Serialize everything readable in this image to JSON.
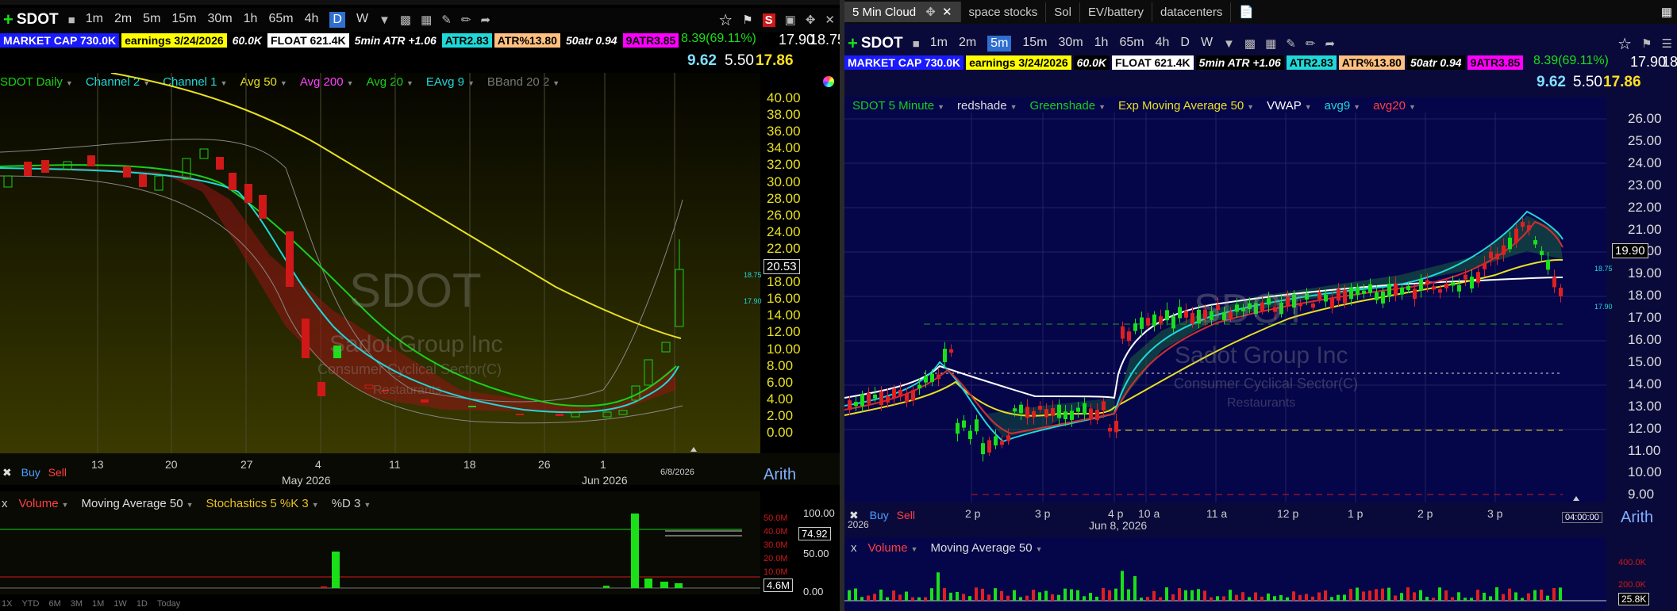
{
  "left": {
    "symbol": "SDOT",
    "timeframes": [
      "1m",
      "2m",
      "5m",
      "15m",
      "30m",
      "1h",
      "65m",
      "4h",
      "D",
      "W"
    ],
    "active_tf": "D",
    "badges": [
      {
        "text": "MARKET CAP 730.0K",
        "bg": "#1a1aff",
        "fg": "#fff"
      },
      {
        "text": "earnings 3/24/2026",
        "bg": "#ffff00",
        "fg": "#000"
      },
      {
        "text": "60.0K",
        "bg": "#000",
        "fg": "#fff"
      },
      {
        "text": "FLOAT 621.4K",
        "bg": "#ffffff",
        "fg": "#000"
      },
      {
        "text": "5min ATR +1.06",
        "bg": "#000",
        "fg": "#fff"
      },
      {
        "text": "ATR2.83",
        "bg": "#20d8d8",
        "fg": "#000"
      },
      {
        "text": "ATR%13.80",
        "bg": "#ffc080",
        "fg": "#000"
      },
      {
        "text": "50atr 0.94",
        "bg": "#000",
        "fg": "#fff"
      },
      {
        "text": "9ATR3.85",
        "bg": "#ff00ff",
        "fg": "#000"
      }
    ],
    "change": "8.39(69.11%)",
    "bid": "17.90",
    "ask": "18.75",
    "stat1": "9.62",
    "stat2": "5.50",
    "stat3": "17.86",
    "studies": [
      {
        "label": "SDOT Daily",
        "color": "#19d019"
      },
      {
        "label": "Channel 2",
        "color": "#20d8d8"
      },
      {
        "label": "Channel 1",
        "color": "#20d8d8"
      },
      {
        "label": "Avg 50",
        "color": "#e8e020"
      },
      {
        "label": "Avg 200",
        "color": "#ff40ff"
      },
      {
        "label": "Avg 20",
        "color": "#19d019"
      },
      {
        "label": "EAvg 9",
        "color": "#20d8d8"
      },
      {
        "label": "BBand 20 2",
        "color": "#777"
      }
    ],
    "yticks": [
      "40.00",
      "38.00",
      "36.00",
      "34.00",
      "32.00",
      "30.00",
      "28.00",
      "26.00",
      "24.00",
      "22.00",
      "20.00",
      "18.00",
      "16.00",
      "14.00",
      "12.00",
      "10.00",
      "8.00",
      "6.00",
      "4.00",
      "2.00",
      "0.00"
    ],
    "xticks": [
      "13",
      "20",
      "27",
      "4",
      "11",
      "18",
      "26",
      "1"
    ],
    "month_labels": [
      "May 2026",
      "Jun 2026"
    ],
    "date_label": "6/8/2026",
    "last_price": "20.53",
    "side_labels": [
      "18.75",
      "17.90"
    ],
    "watermark": {
      "symbol": "SDOT",
      "name": "Sadot Group Inc",
      "sector": "Consumer Cyclical Sector(C)",
      "industry": "Restaurants"
    },
    "buy": "Buy",
    "sell": "Sell",
    "scale": "Arith",
    "lower_studies": [
      {
        "label": "Volume",
        "color": "#ff4040"
      },
      {
        "label": "Moving Average 50",
        "color": "#ddd"
      },
      {
        "label": "Stochastics 5 %K 3",
        "color": "#e8c020"
      },
      {
        "label": "%D 3",
        "color": "#ccc"
      }
    ],
    "vol_ticks": [
      "50.0M",
      "40.0M",
      "30.0M",
      "20.0M",
      "10.0M"
    ],
    "stoch_ticks": [
      "100.00",
      "50.00",
      "0.00"
    ],
    "vol_box1": "74.92",
    "vol_box2": "4.6M",
    "bottom_ranges": [
      "1X",
      "YTD",
      "6M",
      "3M",
      "1M",
      "1W",
      "1D",
      "Today"
    ]
  },
  "right": {
    "tabs": [
      "5 Min Cloud",
      "space stocks",
      "Sol",
      "EV/battery",
      "datacenters"
    ],
    "symbol": "SDOT",
    "timeframes": [
      "1m",
      "2m",
      "5m",
      "15m",
      "30m",
      "1h",
      "65m",
      "4h",
      "D",
      "W"
    ],
    "active_tf": "5m",
    "change": "8.39(69.11%)",
    "bid": "17.90",
    "ask": "18.",
    "stat1": "9.62",
    "stat2": "5.50",
    "stat3": "17.86",
    "studies": [
      {
        "label": "SDOT 5 Minute",
        "color": "#19d019"
      },
      {
        "label": "redshade",
        "color": "#ddd"
      },
      {
        "label": "Greenshade",
        "color": "#19d019"
      },
      {
        "label": "Exp Moving Average 50",
        "color": "#e8e020"
      },
      {
        "label": "VWAP",
        "color": "#fff"
      },
      {
        "label": "avg9",
        "color": "#20d8d8"
      },
      {
        "label": "avg20",
        "color": "#ff4040"
      }
    ],
    "yticks": [
      "26.00",
      "25.00",
      "24.00",
      "23.00",
      "22.00",
      "21.00",
      "20.00",
      "19.00",
      "18.00",
      "17.00",
      "16.00",
      "15.00",
      "14.00",
      "13.00",
      "12.00",
      "11.00",
      "10.00",
      "9.00"
    ],
    "xticks": [
      "2 p",
      "3 p",
      "4 p",
      "10 a",
      "11 a",
      "12 p",
      "1 p",
      "2 p",
      "3 p"
    ],
    "date_label": "Jun 8, 2026",
    "time_box": "04:00:00",
    "last_price": "19.90",
    "side_labels": [
      "18.75",
      "17.90"
    ],
    "buy": "Buy",
    "sell": "Sell",
    "scale": "Arith",
    "lower_studies": [
      {
        "label": "Volume",
        "color": "#ff4040"
      },
      {
        "label": "Moving Average 50",
        "color": "#ddd"
      }
    ],
    "vol_ticks": [
      "400.0K",
      "200.0K"
    ],
    "vol_box": "25.8K",
    "year_label": "2026"
  }
}
